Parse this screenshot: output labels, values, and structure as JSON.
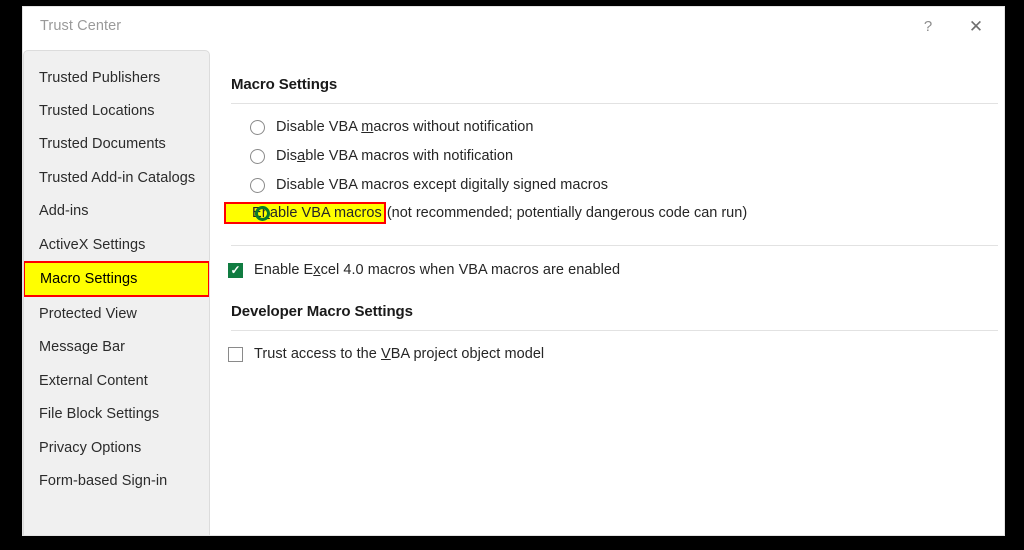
{
  "window": {
    "title": "Trust Center",
    "help_label": "?",
    "close_label": "✕"
  },
  "sidebar": {
    "items": [
      {
        "label": "Trusted Publishers",
        "selected": false
      },
      {
        "label": "Trusted Locations",
        "selected": false
      },
      {
        "label": "Trusted Documents",
        "selected": false
      },
      {
        "label": "Trusted Add-in Catalogs",
        "selected": false
      },
      {
        "label": "Add-ins",
        "selected": false
      },
      {
        "label": "ActiveX Settings",
        "selected": false
      },
      {
        "label": "Macro Settings",
        "selected": true
      },
      {
        "label": "Protected View",
        "selected": false
      },
      {
        "label": "Message Bar",
        "selected": false
      },
      {
        "label": "External Content",
        "selected": false
      },
      {
        "label": "File Block Settings",
        "selected": false
      },
      {
        "label": "Privacy Options",
        "selected": false
      },
      {
        "label": "Form-based Sign-in",
        "selected": false
      }
    ]
  },
  "macro_settings": {
    "heading": "Macro Settings",
    "options": [
      {
        "pre": "Disable VBA ",
        "accel": "m",
        "post": "acros without notification",
        "selected": false,
        "highlighted": false,
        "tail": ""
      },
      {
        "pre": "Dis",
        "accel": "a",
        "post": "ble VBA macros with notification",
        "selected": false,
        "highlighted": false,
        "tail": ""
      },
      {
        "pre": "Disable VBA macros except di",
        "accel": "g",
        "post": "itally signed macros",
        "selected": false,
        "highlighted": false,
        "tail": ""
      },
      {
        "pre": "E",
        "accel": "n",
        "post": "able VBA macros",
        "selected": true,
        "highlighted": true,
        "tail": "(not recommended; potentially dangerous code can run)"
      }
    ],
    "excel4_checkbox": {
      "pre": "Enable E",
      "accel": "x",
      "post": "cel 4.0 macros when VBA macros are enabled",
      "checked": true
    }
  },
  "developer_macro_settings": {
    "heading": "Developer Macro Settings",
    "trust_access_checkbox": {
      "pre": "Trust access to the ",
      "accel": "V",
      "post": "BA project object model",
      "checked": false
    }
  },
  "colors": {
    "highlight_yellow": "#ffff00",
    "highlight_border_red": "#ff0000",
    "radio_selected_green": "#0b7a2a",
    "checkbox_green": "#107c41",
    "sidebar_bg": "#f0f0f0",
    "separator": "#e2e2e2"
  }
}
